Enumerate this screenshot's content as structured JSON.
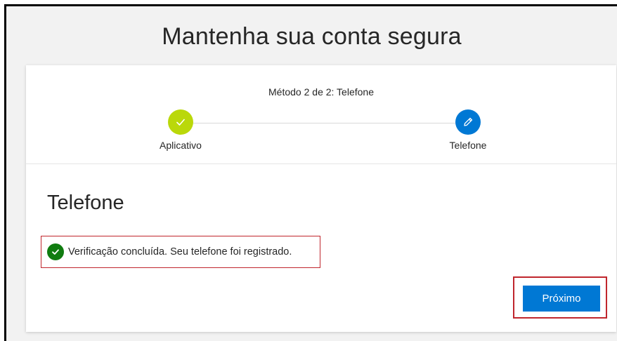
{
  "page": {
    "title": "Mantenha sua conta segura"
  },
  "steps": {
    "caption": "Método 2 de 2: Telefone",
    "items": [
      {
        "label": "Aplicativo",
        "status": "completed",
        "icon": "check-icon"
      },
      {
        "label": "Telefone",
        "status": "current",
        "icon": "pencil-icon"
      }
    ]
  },
  "section": {
    "title": "Telefone"
  },
  "status": {
    "message": "Verificação concluída. Seu telefone foi registrado.",
    "icon": "check-circle-icon"
  },
  "actions": {
    "next_label": "Próximo"
  },
  "colors": {
    "accent": "#0078d4",
    "step_done": "#bad80a",
    "success": "#107c10",
    "highlight": "#c0262d"
  }
}
